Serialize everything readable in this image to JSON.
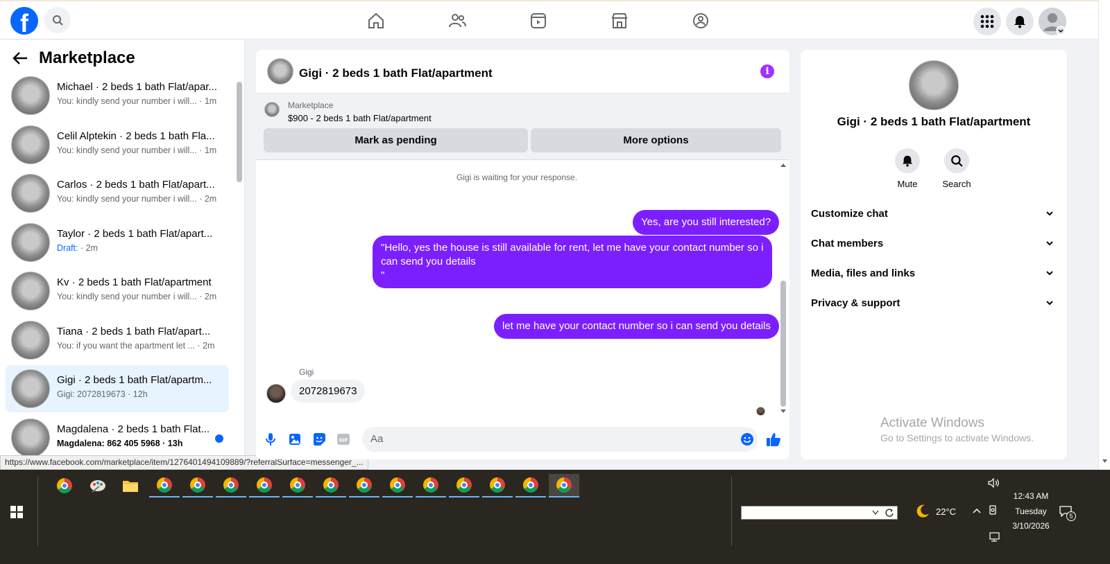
{
  "topbar": {
    "logo_icon": "facebook-logo-icon",
    "nav_icons": [
      "home-icon",
      "friends-icon",
      "video-icon",
      "marketplace-icon",
      "groups-icon"
    ],
    "right_icons": [
      "menu-grid-icon",
      "notifications-bell-icon",
      "account-avatar-icon"
    ]
  },
  "sidebar": {
    "title": "Marketplace",
    "conversations": [
      {
        "name": "Michael · 2 beds 1 bath Flat/apar...",
        "preview": "You: kindly send your number i will... · 1m"
      },
      {
        "name": "Celil Alptekin · 2 beds 1 bath Fla...",
        "preview": "You: kindly send your number i will... · 1m"
      },
      {
        "name": "Carlos · 2 beds 1 bath Flat/apart...",
        "preview": "You: kindly send your number i will... · 2m"
      },
      {
        "name": "Taylor · 2 beds 1 bath Flat/apart...",
        "draft": "Draft:",
        "preview": " · 2m"
      },
      {
        "name": "Kv · 2 beds 1 bath Flat/apartment",
        "preview": "You: kindly send your number i will... · 2m"
      },
      {
        "name": "Tiana · 2 beds 1 bath Flat/apart...",
        "preview": "You: if you want the apartment let ... · 2m"
      },
      {
        "name": "Gigi · 2 beds 1 bath Flat/apartm...",
        "preview": "Gigi: 2072819673 · 12h"
      },
      {
        "name": "Magdalena · 2 beds 1 bath Flat...",
        "preview": "Magdalena: 862 405 5968 · 13h"
      }
    ]
  },
  "status_url": "https://www.facebook.com/marketplace/item/1276401494109889/?referralSurface=messenger_...",
  "chat": {
    "title": "Gigi · 2 beds 1 bath Flat/apartment",
    "marketplace_label": "Marketplace",
    "listing": "$900 - 2 beds 1 bath Flat/apartment",
    "mark_pending": "Mark as pending",
    "more_options": "More options",
    "waiting": "Gigi is waiting for your response.",
    "msg1": "Yes, are you still interested?",
    "msg2_line1": "\"Hello, yes the house is still available for rent, let me have your contact number so i",
    "msg2_line2": "can send you details",
    "msg2_line3": "\"",
    "msg3": "let me have your contact number so i can send you details",
    "sender": "Gigi",
    "reply": "2072819673",
    "input_placeholder": "Aa"
  },
  "info_panel": {
    "name": "Gigi · 2 beds 1 bath Flat/apartment",
    "mute": "Mute",
    "search": "Search",
    "sections": [
      "Customize chat",
      "Chat members",
      "Media, files and links",
      "Privacy & support"
    ],
    "activate_title": "Activate Windows",
    "activate_sub": "Go to Settings to activate Windows."
  },
  "taskbar": {
    "temperature": "22°C",
    "time": "12:43 AM",
    "day": "Tuesday",
    "date": "3/10/2026",
    "notification_count": "5"
  }
}
